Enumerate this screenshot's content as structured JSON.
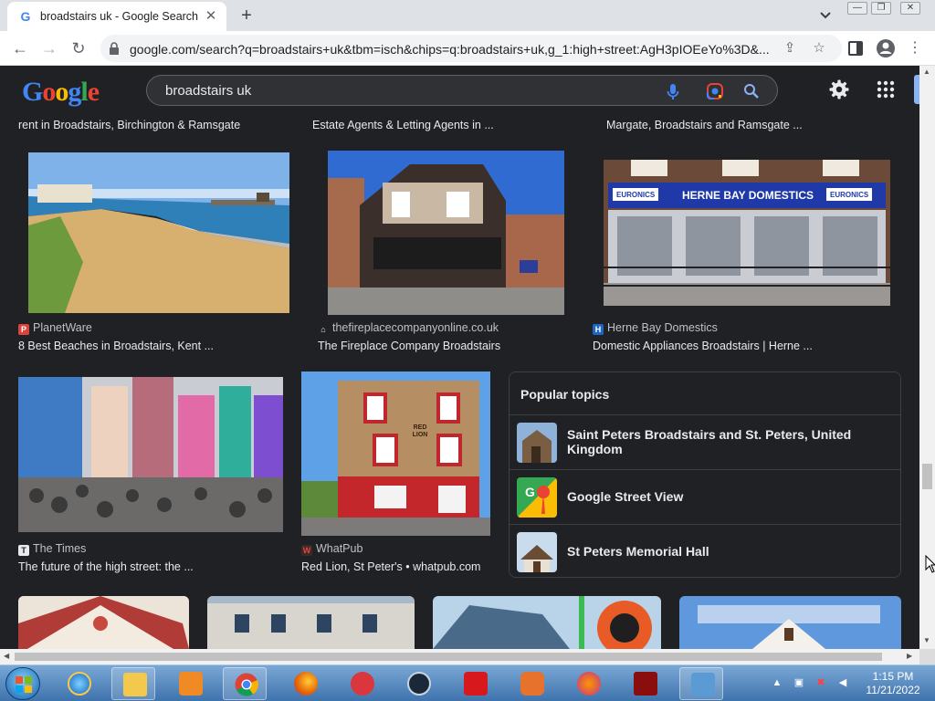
{
  "browser": {
    "tab_title": "broadstairs uk - Google Search",
    "url": "google.com/search?q=broadstairs+uk&tbm=isch&chips=q:broadstairs+uk,g_1:high+street:AgH3pIOEeYo%3D&..."
  },
  "google": {
    "logo_text": "Google",
    "search_query": "broadstairs uk"
  },
  "top_captions": [
    "rent in Broadstairs, Birchington & Ramsgate",
    "Estate Agents & Letting Agents in ...",
    "Margate, Broadstairs and Ramsgate ..."
  ],
  "results_row1": [
    {
      "source": "PlanetWare",
      "title": "8 Best Beaches in Broadstairs, Kent ..."
    },
    {
      "source": "thefireplacecompanyonline.co.uk",
      "title": "The Fireplace Company Broadstairs"
    },
    {
      "source": "Herne Bay Domestics",
      "title": "Domestic Appliances Broadstairs | Herne ..."
    }
  ],
  "results_row2": [
    {
      "source": "The Times",
      "title": "The future of the high street: the ..."
    },
    {
      "source": "WhatPub",
      "title": "Red Lion, St Peter's • whatpub.com"
    }
  ],
  "shop_signs": {
    "main": "HERNE BAY DOMESTICS",
    "brand": "EURONICS",
    "pub": "RED LION"
  },
  "popular_topics": {
    "title": "Popular topics",
    "items": [
      {
        "name": "Saint Peters Broadstairs and St. Peters, United Kingdom"
      },
      {
        "name": "Google Street View"
      },
      {
        "name": "St Peters Memorial Hall"
      }
    ]
  },
  "taskbar": {
    "time": "1:15 PM",
    "date": "11/21/2022"
  },
  "colors": {
    "background": "#202124",
    "text": "#e8eaed",
    "accent": "#8ab4f8"
  }
}
